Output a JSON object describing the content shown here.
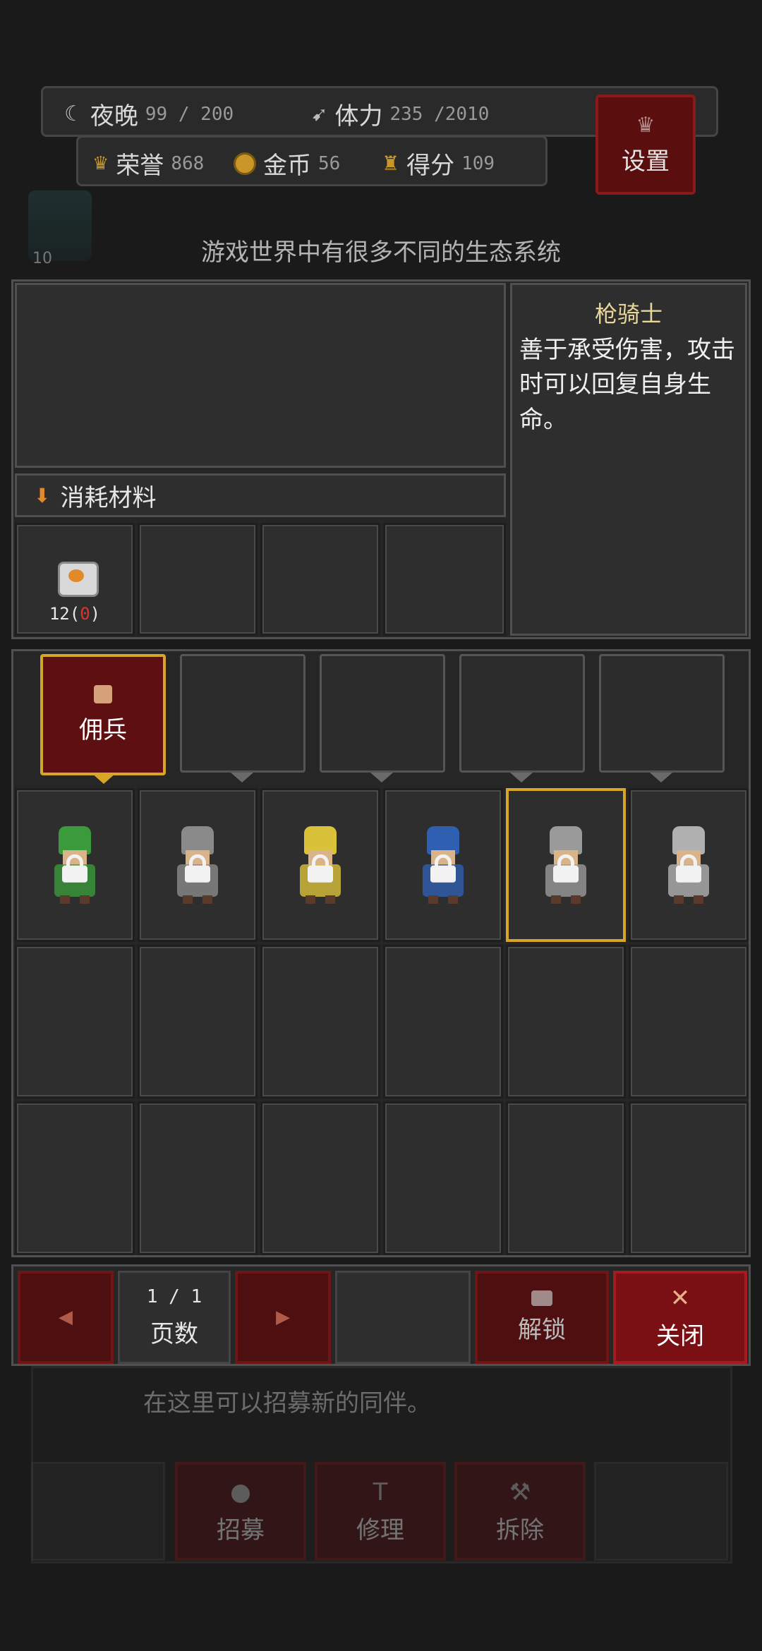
{
  "header": {
    "night_label": "夜晚",
    "night_value": "99 / 200",
    "stamina_label": "体力",
    "stamina_value": "235 /2010",
    "honor_label": "荣誉",
    "honor_value": "868",
    "gold_label": "金币",
    "gold_value": "56",
    "score_label": "得分",
    "score_value": "109",
    "settings_label": "设置"
  },
  "hint_top": "游戏世界中有很多不同的生态系统",
  "side_counter": "10",
  "materials": {
    "section_label": "消耗材料",
    "items": [
      {
        "icon": "jar-icon",
        "count": "12(",
        "count_red": "0",
        "count_end": ")"
      }
    ]
  },
  "description": {
    "title": "枪骑士",
    "text": "善于承受伤害，攻击时可以回复自身生命。"
  },
  "tabs": {
    "active_label": "佣兵"
  },
  "units": [
    {
      "name": "green-elf-archer",
      "locked": true,
      "color": "#3a9a3c"
    },
    {
      "name": "gray-swordsman",
      "locked": true,
      "color": "#8a8a8a"
    },
    {
      "name": "yellow-mage",
      "locked": true,
      "color": "#d9c13a"
    },
    {
      "name": "blue-hair-archer",
      "locked": true,
      "color": "#2f5fb0"
    },
    {
      "name": "lancer-knight",
      "locked": true,
      "color": "#9a9a9a",
      "selected": true
    },
    {
      "name": "heavy-knight",
      "locked": true,
      "color": "#b0b0b0"
    }
  ],
  "pager": {
    "page": "1 / 1",
    "page_label": "页数",
    "unlock_label": "解锁",
    "close_label": "关闭"
  },
  "background": {
    "recruit_hint": "在这里可以招募新的同伴。",
    "recruit_label": "招募",
    "repair_label": "修理",
    "dismantle_label": "拆除"
  }
}
